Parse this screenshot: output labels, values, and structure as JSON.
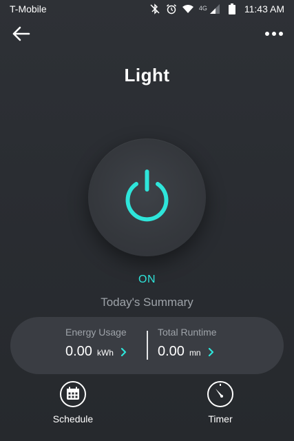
{
  "status_bar": {
    "carrier": "T-Mobile",
    "network": "4G",
    "time": "11:43 AM",
    "icons": [
      "bluetooth-off-icon",
      "alarm-icon",
      "wifi-icon",
      "cell-signal-icon",
      "battery-icon"
    ]
  },
  "header": {
    "title": "Light",
    "back_icon": "arrow-left-icon",
    "more_icon": "more-horizontal-icon"
  },
  "power": {
    "icon": "power-icon",
    "state": "ON",
    "accent_color": "#2ee5da"
  },
  "summary": {
    "title": "Today's Summary",
    "energy": {
      "label": "Energy Usage",
      "value": "0.00",
      "unit": "kWh"
    },
    "runtime": {
      "label": "Total Runtime",
      "value": "0.00",
      "unit": "mn"
    }
  },
  "actions": [
    {
      "label": "Schedule",
      "icon": "calendar-icon"
    },
    {
      "label": "Timer",
      "icon": "timer-icon"
    }
  ]
}
